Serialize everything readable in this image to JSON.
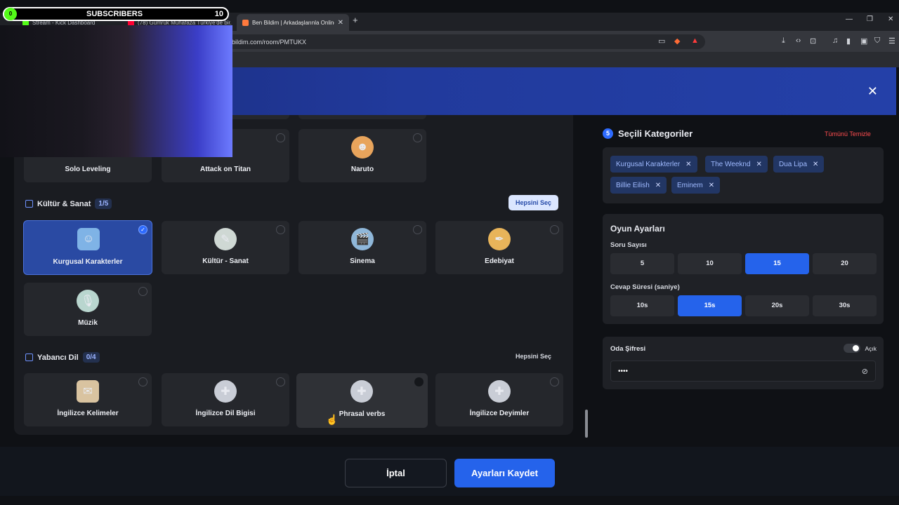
{
  "overlay": {
    "subscribers_label": "SUBSCRIBERS",
    "subscribers_count": "10",
    "circle_text": "0"
  },
  "browser": {
    "tabs": [
      {
        "label": "Stream - Kick Dashboard",
        "fav_color": "#53fc18"
      },
      {
        "label": "(78) Gümrük Muhafaza Türkiye'de bir...",
        "fav_color": "#ff0033"
      },
      {
        "label": "Ben Bildim | Arkadaşlarınla Online...",
        "fav_color": "#ff7a3d"
      }
    ],
    "new_tab": "+",
    "url": "bildim.com/room/PMTUKX"
  },
  "left": {
    "anime_cards": [
      "Solo Leveling",
      "Attack on Titan",
      "Naruto"
    ],
    "culture": {
      "title": "Kültür & Sanat",
      "count": "1/5",
      "select_all": "Hepsini Seç",
      "cards": [
        "Kurgusal Karakterler",
        "Kültür - Sanat",
        "Sinema",
        "Edebiyat",
        "Müzik"
      ]
    },
    "language": {
      "title": "Yabancı Dil",
      "count": "0/4",
      "select_all": "Hepsini Seç",
      "cards": [
        "İngilizce Kelimeler",
        "İngilizce Dil Bigisi",
        "Phrasal verbs",
        "İngilizce Deyimler"
      ]
    }
  },
  "right": {
    "selected": {
      "count": "5",
      "title": "Seçili Kategoriler",
      "clear_all": "Tümünü Temizle",
      "tags": [
        "Kurgusal Karakterler",
        "The Weeknd",
        "Dua Lipa",
        "Billie Eilish",
        "Eminem"
      ]
    },
    "settings": {
      "title": "Oyun Ayarları",
      "question_label": "Soru Sayısı",
      "question_options": [
        "5",
        "10",
        "15",
        "20"
      ],
      "question_selected": "15",
      "time_label": "Cevap Süresi (saniye)",
      "time_options": [
        "10s",
        "15s",
        "20s",
        "30s"
      ],
      "time_selected": "15s"
    },
    "password": {
      "label": "Oda Şifresi",
      "toggle_label": "Açık",
      "value": "••••"
    }
  },
  "footer": {
    "cancel": "İptal",
    "save": "Ayarları Kaydet"
  },
  "accent": "#2563eb"
}
